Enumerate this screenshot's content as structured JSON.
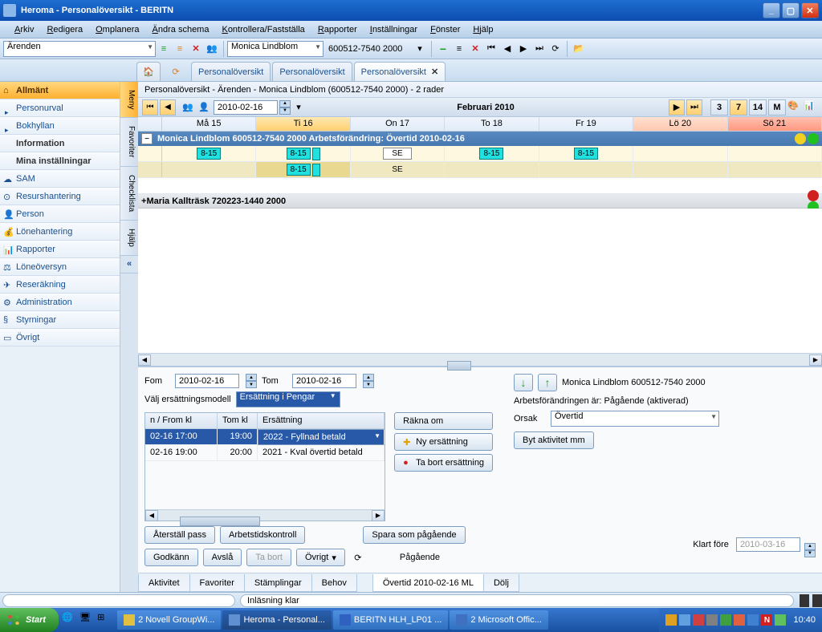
{
  "title": "Heroma - Personalöversikt - BERITN",
  "menubar": [
    "Arkiv",
    "Redigera",
    "Omplanera",
    "Ändra schema",
    "Kontrollera/Fastställa",
    "Rapporter",
    "Inställningar",
    "Fönster",
    "Hjälp"
  ],
  "toolbar": {
    "arenden_label": "Ärenden",
    "person_name": "Monica Lindblom",
    "person_id": "600512-7540 2000"
  },
  "tabs": [
    "Personalöversikt",
    "Personalöversikt",
    "Personalöversikt"
  ],
  "sidebar": {
    "items": [
      {
        "label": "Allmänt",
        "active": true,
        "bold": true
      },
      {
        "label": "Personurval",
        "arrow": true
      },
      {
        "label": "Bokhyllan",
        "arrow": true
      },
      {
        "label": "Information",
        "bold": true
      },
      {
        "label": "Mina inställningar",
        "bold": true
      },
      {
        "label": "SAM"
      },
      {
        "label": "Resurshantering"
      },
      {
        "label": "Person"
      },
      {
        "label": "Lönehantering"
      },
      {
        "label": "Rapporter"
      },
      {
        "label": "Löneöversyn"
      },
      {
        "label": "Reseräkning"
      },
      {
        "label": "Administration"
      },
      {
        "label": "Styrningar"
      },
      {
        "label": "Övrigt"
      }
    ]
  },
  "vtabs": [
    "Meny",
    "Favoriter",
    "Checklista",
    "Hjälp"
  ],
  "breadcrumb": "Personalöversikt - Ärenden - Monica Lindblom (600512-7540 2000) - 2 rader",
  "calendar": {
    "date": "2010-02-16",
    "month_label": "Februari 2010",
    "view_buttons": [
      "3",
      "7",
      "14",
      "M"
    ],
    "days": [
      {
        "label": "Må 15"
      },
      {
        "label": "Ti 16",
        "sel": true
      },
      {
        "label": "On 17"
      },
      {
        "label": "To 18"
      },
      {
        "label": "Fr 19"
      },
      {
        "label": "Lö 20",
        "wkend": true
      },
      {
        "label": "Sö 21",
        "wkend": true
      }
    ]
  },
  "person1": {
    "header": "Monica   Lindblom   600512-7540 2000   Arbetsförändring: Övertid 2010-02-16",
    "shifts_row1": [
      "8-15",
      "8-15",
      "SE",
      "8-15",
      "8-15",
      "",
      ""
    ],
    "shifts_row2": [
      "",
      "8-15",
      "SE",
      "",
      "",
      "",
      ""
    ]
  },
  "person2": {
    "header": "Maria   Kallträsk   720223-1440 2000"
  },
  "bottom": {
    "fom_label": "Fom",
    "fom_date": "2010-02-16",
    "tom_label": "Tom",
    "tom_date": "2010-02-16",
    "model_label": "Välj ersättningsmodell",
    "model_value": "Ersättning i Pengar",
    "table": {
      "headers": [
        "n / From kl",
        "Tom kl",
        "Ersättning"
      ],
      "rows": [
        {
          "from": "02-16 17:00",
          "tom": "19:00",
          "ers": "2022 - Fyllnad betald",
          "sel": true
        },
        {
          "from": "02-16 19:00",
          "tom": "20:00",
          "ers": "2021 - Kval övertid betald"
        }
      ]
    },
    "btn_rakna": "Räkna om",
    "btn_ny": "Ny ersättning",
    "btn_tabort": "Ta bort ersättning",
    "person_info": "Monica Lindblom 600512-7540 2000",
    "status_text": "Arbetsförändringen är: Pågående (aktiverad)",
    "orsak_label": "Orsak",
    "orsak_value": "Övertid",
    "btn_byt": "Byt aktivitet mm",
    "btn_aterstall": "Återställ pass",
    "btn_arbetstid": "Arbetstidskontroll",
    "btn_spara": "Spara som pågående",
    "btn_godkann": "Godkänn",
    "btn_avsla": "Avslå",
    "btn_tabort2": "Ta bort",
    "btn_ovrigt": "Övrigt",
    "pagaende": "Pågående",
    "klart_label": "Klart före",
    "klart_date": "2010-03-16",
    "tabs": [
      "Aktivitet",
      "Favoriter",
      "Stämplingar",
      "Behov",
      "Övertid  2010-02-16 ML",
      "Dölj"
    ]
  },
  "statusbar": {
    "text": "Inläsning klar"
  },
  "taskbar": {
    "start": "Start",
    "items": [
      {
        "label": "2 Novell GroupWi...",
        "color": "#e0c040"
      },
      {
        "label": "Heroma - Personal...",
        "active": true,
        "color": "#6090d0"
      },
      {
        "label": "BERITN HLH_LP01 ...",
        "color": "#3060c0"
      },
      {
        "label": "2 Microsoft Offic...",
        "color": "#4070c0"
      }
    ],
    "clock": "10:40"
  }
}
